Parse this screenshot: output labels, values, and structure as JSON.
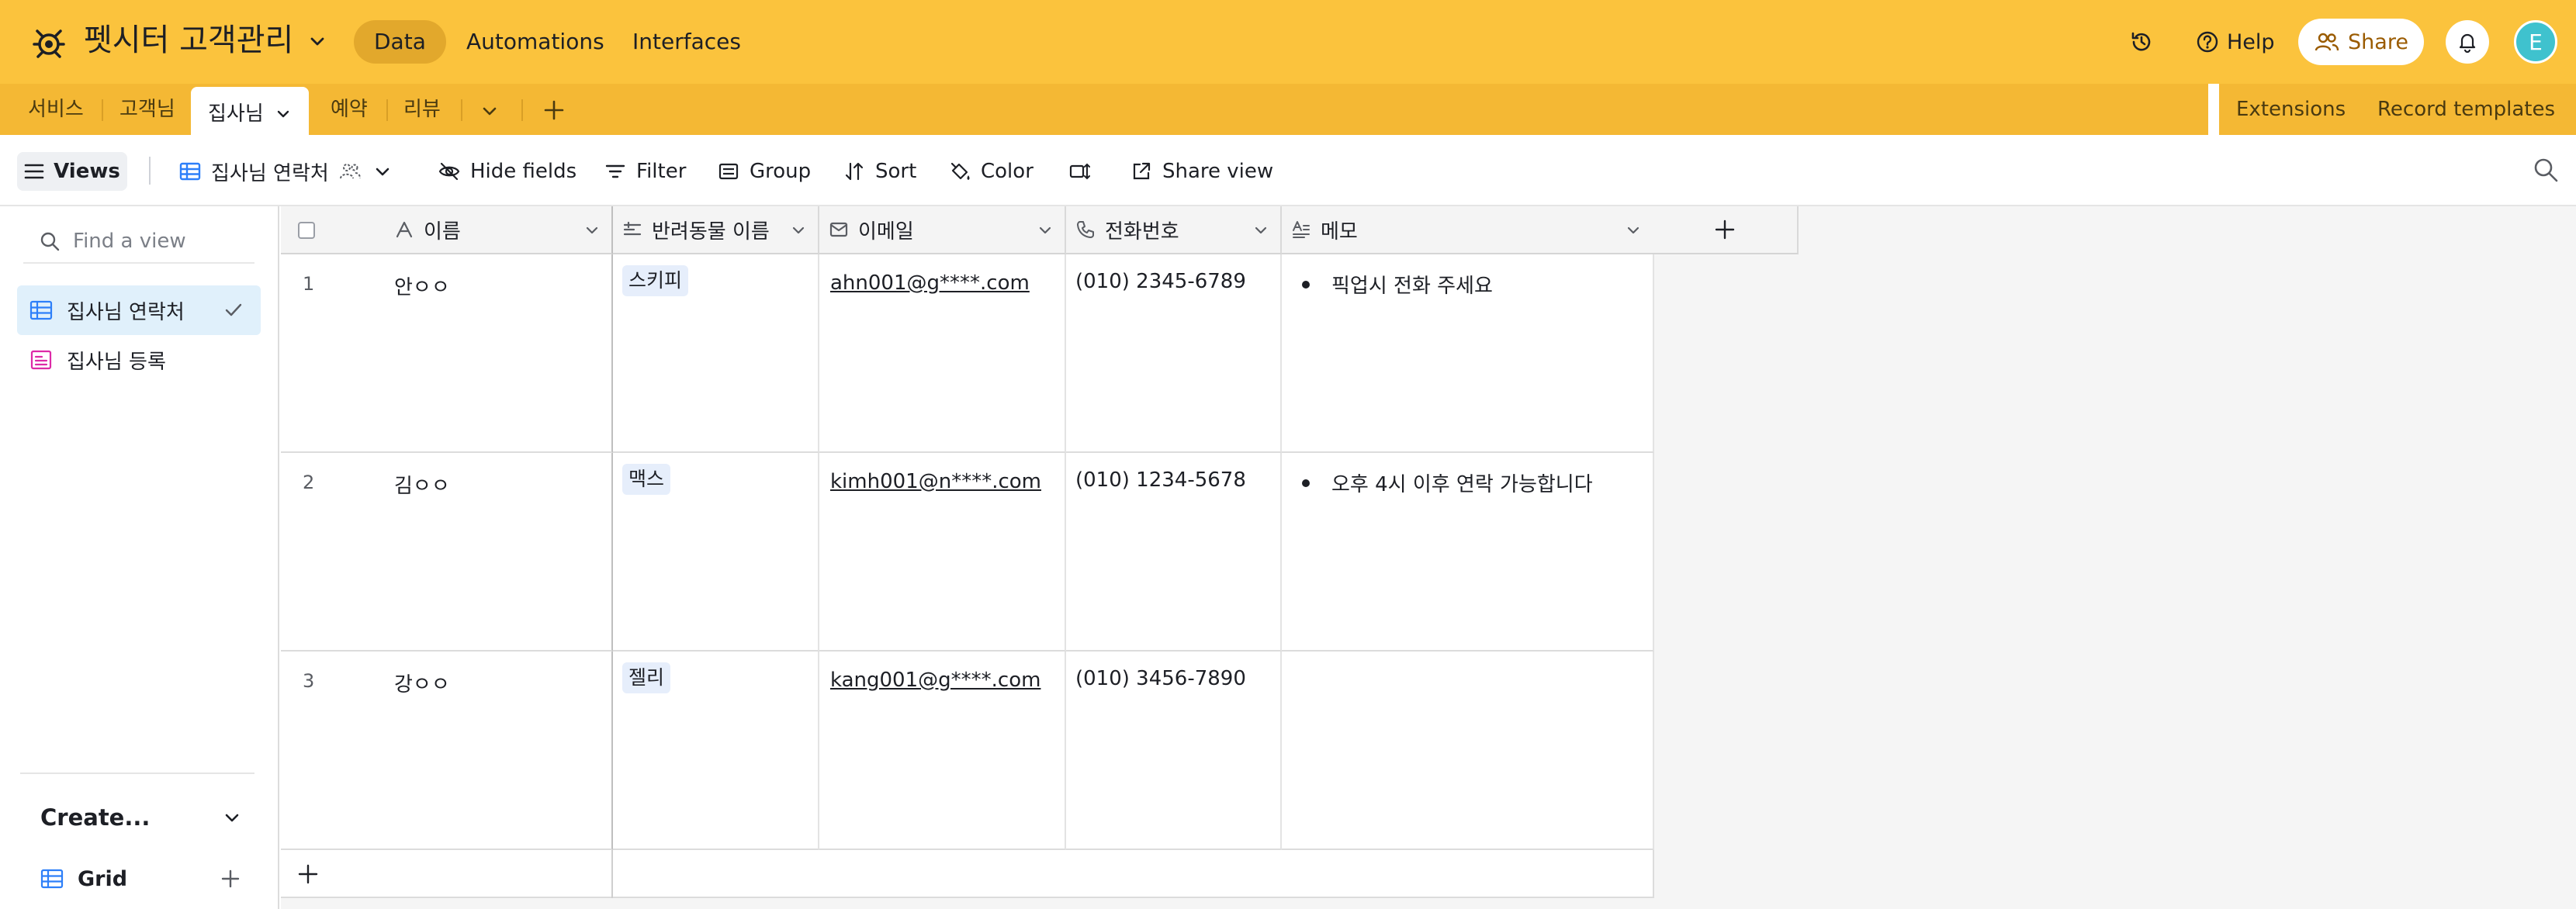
{
  "header": {
    "base_name": "펫시터 고객관리",
    "nav": [
      "Data",
      "Automations",
      "Interfaces"
    ],
    "active_nav": "Data",
    "help_label": "Help",
    "share_label": "Share",
    "avatar_initial": "E"
  },
  "tables": {
    "tabs": [
      "서비스",
      "고객님",
      "집사님",
      "예약",
      "리뷰"
    ],
    "active_tab": "집사님",
    "right_items": [
      "Extensions",
      "Record templates"
    ]
  },
  "viewbar": {
    "views_label": "Views",
    "current_view": "집사님 연락처",
    "hide_fields": "Hide fields",
    "filter": "Filter",
    "group": "Group",
    "sort": "Sort",
    "color": "Color",
    "share_view": "Share view"
  },
  "sidebar": {
    "search_placeholder": "Find a view",
    "views": [
      {
        "label": "집사님 연락처",
        "type": "grid",
        "selected": true
      },
      {
        "label": "집사님 등록",
        "type": "form",
        "selected": false
      }
    ],
    "create_label": "Create...",
    "create_items": [
      {
        "label": "Grid"
      }
    ]
  },
  "grid": {
    "columns": [
      {
        "label": "이름",
        "icon": "text-field-icon"
      },
      {
        "label": "반려동물 이름",
        "icon": "linked-record-icon"
      },
      {
        "label": "이메일",
        "icon": "email-icon"
      },
      {
        "label": "전화번호",
        "icon": "phone-icon"
      },
      {
        "label": "메모",
        "icon": "long-text-icon"
      }
    ],
    "rows": [
      {
        "num": "1",
        "name": "안ㅇㅇ",
        "pet": "스키피",
        "email": "ahn001@g****.com",
        "phone": "(010) 2345-6789",
        "memo": "픽업시 전화 주세요"
      },
      {
        "num": "2",
        "name": "김ㅇㅇ",
        "pet": "맥스",
        "email": "kimh001@n****.com",
        "phone": "(010) 1234-5678",
        "memo": "오후 4시 이후 연락 가능합니다"
      },
      {
        "num": "3",
        "name": "강ㅇㅇ",
        "pet": "젤리",
        "email": "kang001@g****.com",
        "phone": "(010) 3456-7890",
        "memo": ""
      }
    ]
  },
  "colors": {
    "header_bg": "#fbc33d",
    "tabbar_bg": "#f4b834",
    "selected_view_bg": "#e0f0fb",
    "avatar_bg": "#3fc2ce"
  }
}
